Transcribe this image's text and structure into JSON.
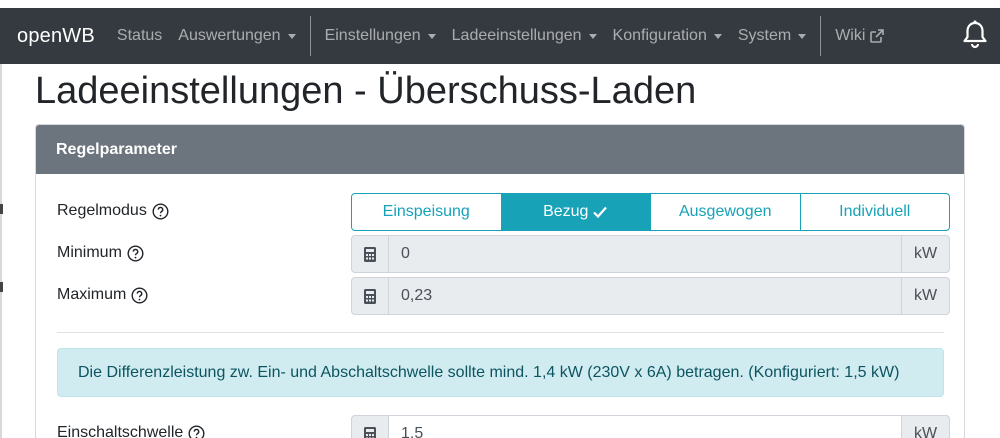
{
  "navbar": {
    "brand": "openWB",
    "items": [
      {
        "label": "Status"
      },
      {
        "label": "Auswertungen"
      },
      {
        "label": "Einstellungen"
      },
      {
        "label": "Ladeeinstellungen"
      },
      {
        "label": "Konfiguration"
      },
      {
        "label": "System"
      },
      {
        "label": "Wiki"
      }
    ]
  },
  "page": {
    "title": "Ladeeinstellungen - Überschuss-Laden"
  },
  "card": {
    "header": "Regelparameter",
    "regelmodus": {
      "label": "Regelmodus",
      "options": [
        "Einspeisung",
        "Bezug",
        "Ausgewogen",
        "Individuell"
      ],
      "selected": "Bezug"
    },
    "minimum": {
      "label": "Minimum",
      "value": "0",
      "unit": "kW"
    },
    "maximum": {
      "label": "Maximum",
      "value": "0,23",
      "unit": "kW"
    },
    "alert": "Die Differenzleistung zw. Ein- und Abschaltschwelle sollte mind. 1,4 kW (230V x 6A) betragen. (Konfiguriert: 1,5 kW)",
    "einschaltschwelle": {
      "label": "Einschaltschwelle",
      "value": "1,5",
      "unit": "kW"
    }
  },
  "colors": {
    "navbar_bg": "#343a40",
    "accent": "#17a2b8",
    "card_header_bg": "#6c757d",
    "alert_bg": "#d1ecf1"
  }
}
